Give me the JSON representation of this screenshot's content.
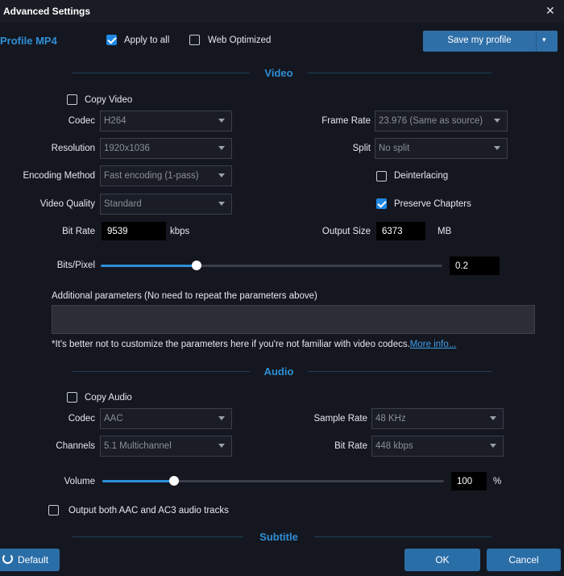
{
  "window": {
    "title": "Advanced Settings",
    "close_glyph": "✕"
  },
  "profile": {
    "name": "Profile MP4"
  },
  "options": {
    "apply_to_all": "Apply to all",
    "apply_to_all_checked": true,
    "web_optimized": "Web Optimized",
    "web_optimized_checked": false
  },
  "save_profile": {
    "label": "Save my profile",
    "arrow": "▾"
  },
  "video": {
    "section_title": "Video",
    "copy_video": "Copy Video",
    "codec": {
      "label": "Codec",
      "value": "H264"
    },
    "resolution": {
      "label": "Resolution",
      "value": "1920x1036"
    },
    "encoding_method": {
      "label": "Encoding Method",
      "value": "Fast encoding (1-pass)"
    },
    "video_quality": {
      "label": "Video Quality",
      "value": "Standard"
    },
    "bit_rate": {
      "label": "Bit Rate",
      "value": "9539",
      "unit": "kbps"
    },
    "frame_rate": {
      "label": "Frame Rate",
      "value": "23.976 (Same as source)"
    },
    "split": {
      "label": "Split",
      "value": "No split"
    },
    "deinterlacing": {
      "label": "Deinterlacing",
      "checked": false
    },
    "preserve_chapters": {
      "label": "Preserve Chapters",
      "checked": true
    },
    "output_size": {
      "label": "Output Size",
      "value": "6373",
      "unit": "MB"
    },
    "bits_per_pixel": {
      "label": "Bits/Pixel",
      "value": "0.2",
      "level": 0.28
    },
    "additional_params": {
      "label": "Additional parameters (No need to repeat the parameters above)",
      "value": ""
    },
    "note": "*It's better not to customize the parameters here if you're not familiar with video codecs.",
    "more_info": "More info..."
  },
  "audio": {
    "section_title": "Audio",
    "copy_audio": "Copy Audio",
    "codec": {
      "label": "Codec",
      "value": "AAC"
    },
    "channels": {
      "label": "Channels",
      "value": "5.1 Multichannel"
    },
    "sample_rate": {
      "label": "Sample Rate",
      "value": "48 KHz"
    },
    "bit_rate": {
      "label": "Bit Rate",
      "value": "448 kbps"
    },
    "volume": {
      "label": "Volume",
      "value": "100",
      "unit": "%",
      "level": 0.21
    },
    "output_both": "Output both AAC and AC3 audio tracks"
  },
  "subtitle": {
    "section_title": "Subtitle"
  },
  "footer": {
    "default_label": "Default",
    "ok_label": "OK",
    "cancel_label": "Cancel"
  },
  "colors": {
    "accent": "#2f8fd6",
    "button": "#2a6ea8",
    "background": "#14171f"
  }
}
